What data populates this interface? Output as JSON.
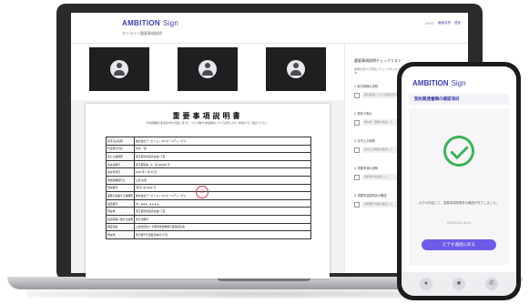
{
  "laptop": {
    "logo": "AMBITION",
    "logo_suffix": "Sign",
    "subtitle": "オンライン重要事項説明",
    "actions": [
      "HOST",
      "画面共有",
      "退室"
    ]
  },
  "document": {
    "title": "重要事項説明書",
    "intro": "宅地建物取引業法第35条の規定に基づき、以下の物件の重要事項について説明します。内容を十分ご確認ください。",
    "rows": [
      [
        "商号又は名称",
        "株式会社アンビション DX ホールディングス"
      ],
      [
        "代表者の氏名",
        "清水 一郎"
      ],
      [
        "主たる事務所",
        "東京都渋谷区道玄坂1丁目"
      ],
      [
        "免許証番号",
        "東京都知事（1）第 000000 号"
      ],
      [
        "免許年月日",
        "2020 年 7 月 23 日"
      ],
      [
        "宅地建物取引士",
        "山田 太郎"
      ],
      [
        "登録番号",
        "(東京) 第 ●●●● 号"
      ],
      [
        "業務に従事する事務所",
        "株式会社アンビション DX ホールディングス"
      ],
      [
        "電話番号",
        "03 - ●●●● - ▲▲▲▲"
      ],
      [
        "所在地",
        "東京都渋谷区道玄坂1丁目"
      ],
      [
        "供託所等に関する説明",
        "東京法務局"
      ],
      [
        "保証協会",
        "公益社団法人 全国宅地建物取引業保証協会"
      ],
      [
        "所在地",
        "東京都千代田区岩本町2丁目"
      ]
    ],
    "seal": "印"
  },
  "checklist": {
    "title": "重要事項説明チェックリスト",
    "description": "説明を受けた項目にチェックを入れてください。全ての確認が完了したら、署名に進みます。",
    "items": [
      {
        "head": "1. 取引態様の説明",
        "field": "取引態様について説明を受けた"
      },
      {
        "head": "2. 物件の表示",
        "field": "所在地・面積を確認した"
      },
      {
        "head": "3. 法令上の制限",
        "field": "法令上の制限を確認した"
      },
      {
        "head": "4. 重要事項の説明",
        "field": "契約条件を確認した"
      },
      {
        "head": "5. 重要事項説明書の確認",
        "field": "説明書の内容を確認した"
      }
    ]
  },
  "phone": {
    "logo": "AMBITION",
    "logo_suffix": "Sign",
    "title": "契約関連書類の確認項目",
    "message": "以下の内容にて、重要事項説明書の確認が完了しました。",
    "date": "2020/11/01  09:41",
    "button": "ビデオ通話に戻る",
    "bottom_icons": [
      "mic-icon",
      "video-icon",
      "phone-icon"
    ]
  }
}
